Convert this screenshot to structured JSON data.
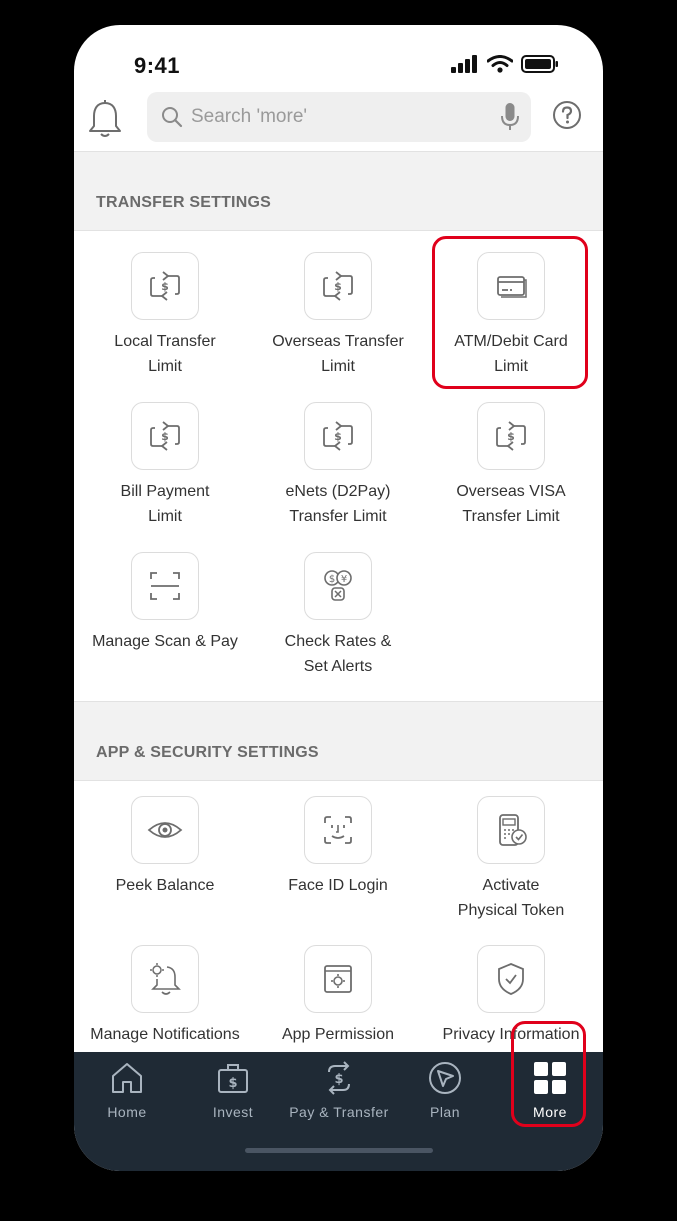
{
  "status": {
    "time": "9:41"
  },
  "search": {
    "placeholder": "Search 'more'"
  },
  "sections": {
    "transfer_title": "TRANSFER SETTINGS",
    "security_title": "APP & SECURITY SETTINGS"
  },
  "transfer_tiles": [
    {
      "line1": "Local Transfer",
      "line2": "Limit",
      "icon": "transfer-icon"
    },
    {
      "line1": "Overseas Transfer",
      "line2": "Limit",
      "icon": "transfer-icon"
    },
    {
      "line1": "ATM/Debit Card",
      "line2": "Limit",
      "icon": "card-icon"
    },
    {
      "line1": "Bill Payment",
      "line2": "Limit",
      "icon": "transfer-icon"
    },
    {
      "line1": "eNets (D2Pay)",
      "line2": "Transfer Limit",
      "icon": "transfer-icon"
    },
    {
      "line1": "Overseas VISA",
      "line2": "Transfer Limit",
      "icon": "transfer-icon"
    },
    {
      "line1": "Manage Scan & Pay",
      "line2": "",
      "icon": "scan-icon"
    },
    {
      "line1": "Check Rates &",
      "line2": "Set Alerts",
      "icon": "currency-alert-icon"
    }
  ],
  "security_tiles": [
    {
      "line1": "Peek Balance",
      "line2": "",
      "icon": "eye-icon"
    },
    {
      "line1": "Face ID Login",
      "line2": "",
      "icon": "face-id-icon"
    },
    {
      "line1": "Activate",
      "line2": "Physical Token",
      "icon": "token-icon"
    },
    {
      "line1": "Manage Notifications",
      "line2": "",
      "icon": "bell-gear-icon"
    },
    {
      "line1": "App Permission",
      "line2": "",
      "icon": "app-settings-icon"
    },
    {
      "line1": "Privacy Information",
      "line2": "",
      "icon": "shield-icon"
    }
  ],
  "nav": [
    {
      "label": "Home",
      "icon": "home-icon"
    },
    {
      "label": "Invest",
      "icon": "invest-bag-icon"
    },
    {
      "label": "Pay & Transfer",
      "icon": "pay-transfer-icon"
    },
    {
      "label": "Plan",
      "icon": "plan-icon"
    },
    {
      "label": "More",
      "icon": "more-grid-icon"
    }
  ],
  "colors": {
    "nav_bg": "#1f2a35",
    "highlight": "#e0001b",
    "section_bg": "#f2f2f2"
  }
}
